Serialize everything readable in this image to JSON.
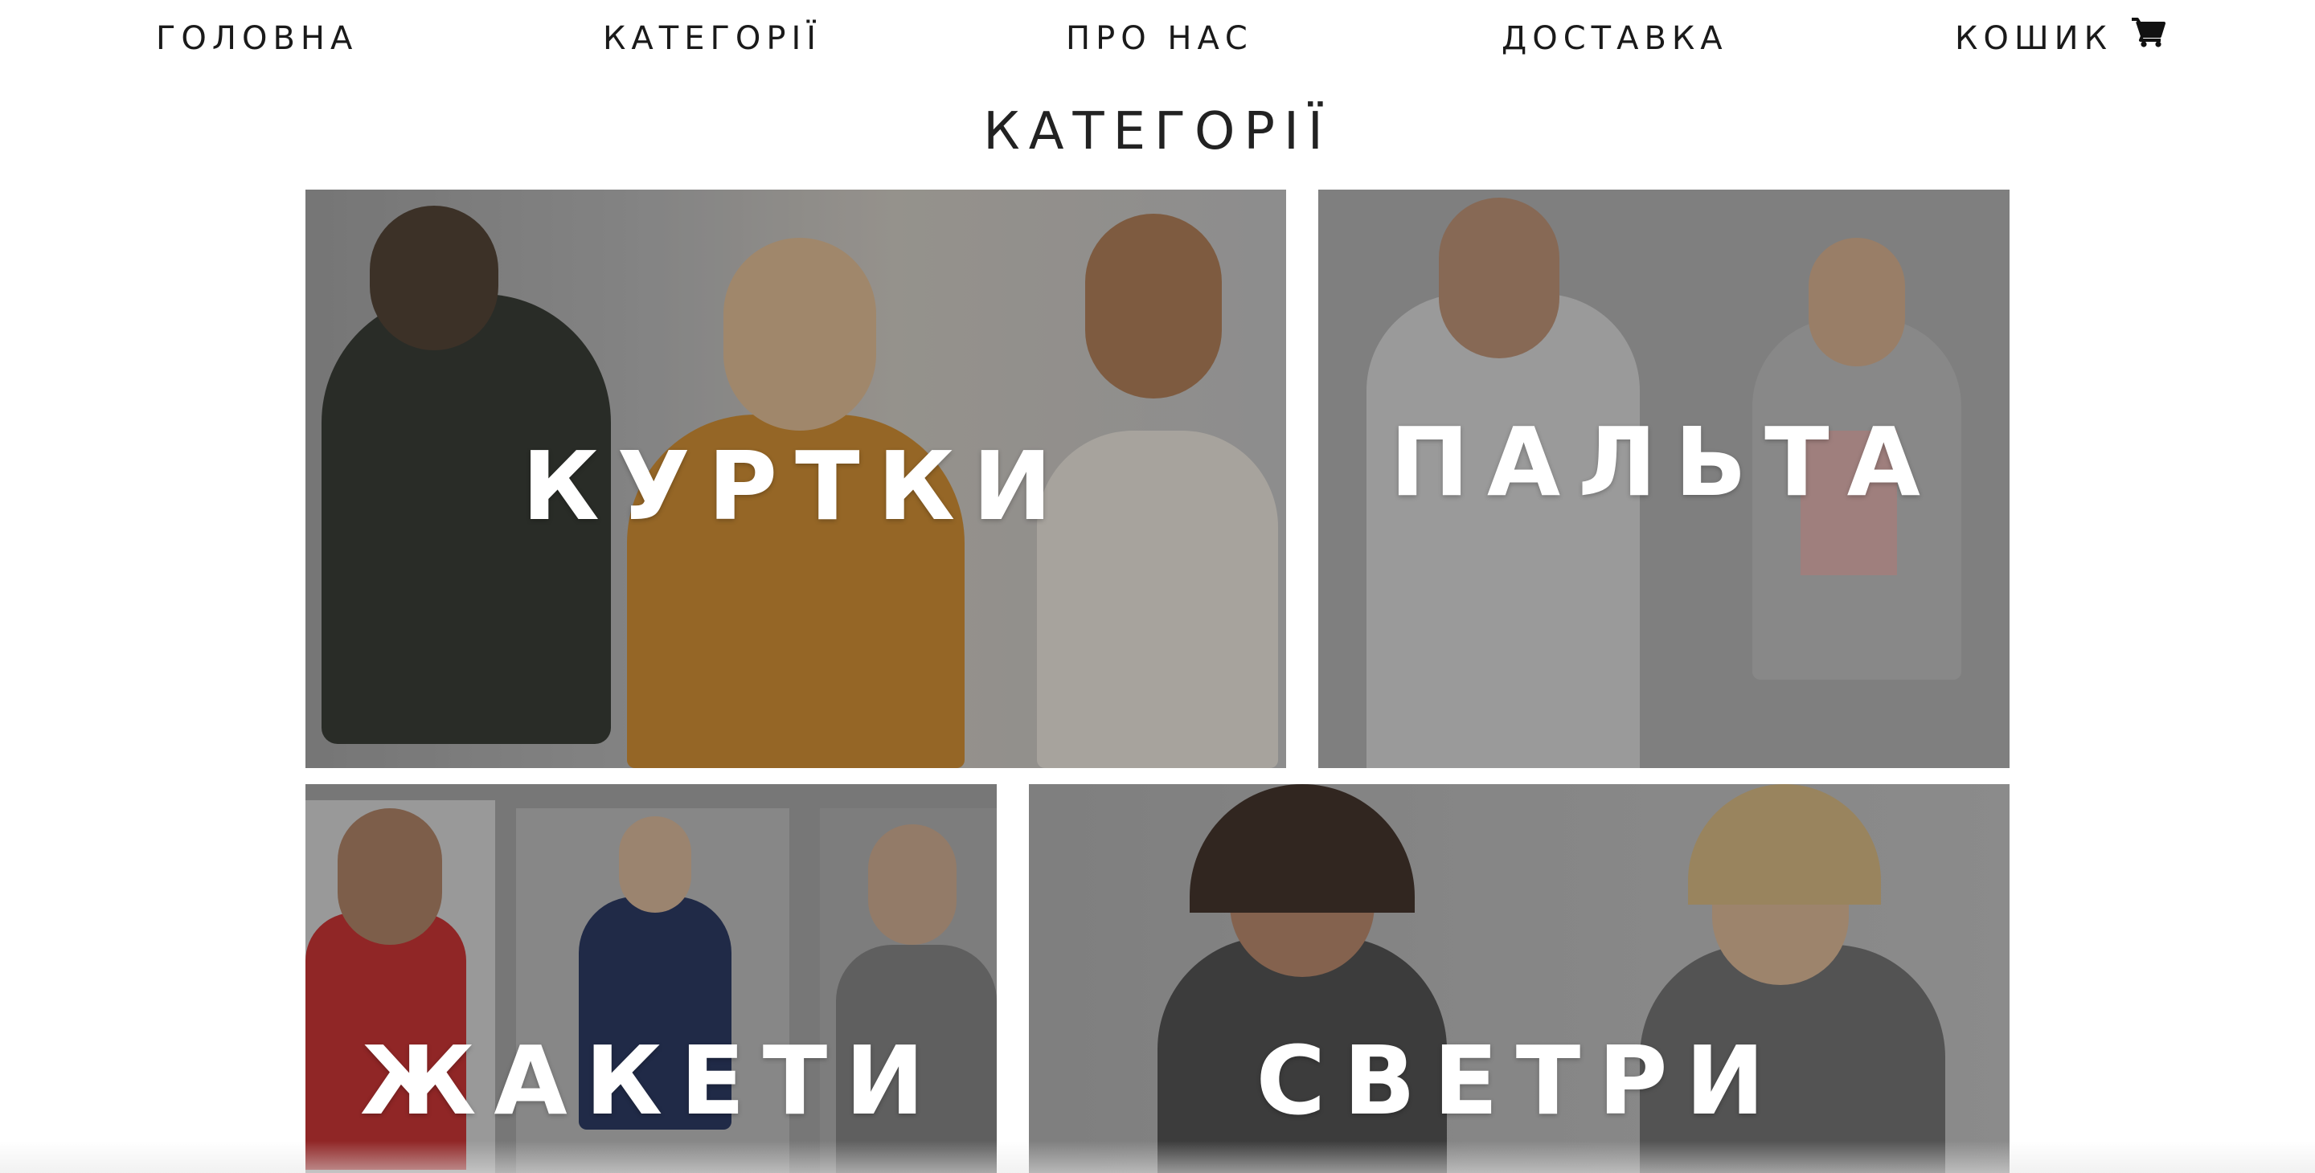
{
  "nav": {
    "items": [
      {
        "label": "ГОЛОВНА"
      },
      {
        "label": "КАТЕГОРІЇ"
      },
      {
        "label": "ПРО НАС"
      },
      {
        "label": "ДОСТАВКА"
      },
      {
        "label": "КОШИК"
      }
    ],
    "cart_icon": "shopping-cart-icon"
  },
  "page": {
    "title": "КАТЕГОРІЇ"
  },
  "categories": [
    {
      "label": "КУРТКИ"
    },
    {
      "label": "ПАЛЬТА"
    },
    {
      "label": "ЖАКЕТИ"
    },
    {
      "label": "СВЕТРИ"
    }
  ],
  "colors": {
    "text": "#1a1a1a",
    "overlay": "#1e1e1e",
    "tile_text": "#ffffff"
  }
}
